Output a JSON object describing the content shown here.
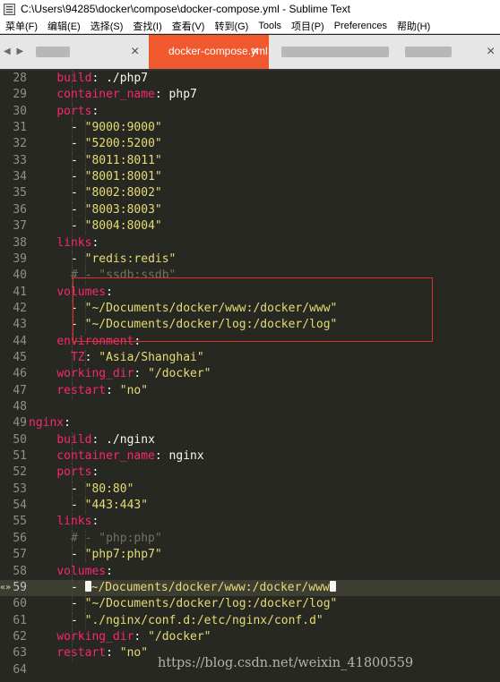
{
  "window": {
    "title": "C:\\Users\\94285\\docker\\compose\\docker-compose.yml - Sublime Text"
  },
  "menu": [
    "菜单(F)",
    "编辑(E)",
    "选择(S)",
    "查找(I)",
    "查看(V)",
    "转到(G)",
    "Tools",
    "项目(P)",
    "Preferences",
    "帮助(H)"
  ],
  "tabs": {
    "nav_arrows": "◀ ▶",
    "active_label": "docker-compose.yml",
    "close_glyph": "×"
  },
  "editor": {
    "lines": [
      {
        "n": "28",
        "indent": 4,
        "tokens": [
          {
            "t": "build",
            "c": "k"
          },
          {
            "t": ": ./php7",
            "c": "p"
          }
        ]
      },
      {
        "n": "29",
        "indent": 4,
        "tokens": [
          {
            "t": "container_name",
            "c": "k"
          },
          {
            "t": ": php7",
            "c": "p"
          }
        ]
      },
      {
        "n": "30",
        "indent": 4,
        "tokens": [
          {
            "t": "ports",
            "c": "k"
          },
          {
            "t": ":",
            "c": "p"
          }
        ]
      },
      {
        "n": "31",
        "indent": 6,
        "tokens": [
          {
            "t": "- ",
            "c": "p"
          },
          {
            "t": "\"9000:9000\"",
            "c": "s"
          }
        ]
      },
      {
        "n": "32",
        "indent": 6,
        "tokens": [
          {
            "t": "- ",
            "c": "p"
          },
          {
            "t": "\"5200:5200\"",
            "c": "s"
          }
        ]
      },
      {
        "n": "33",
        "indent": 6,
        "tokens": [
          {
            "t": "- ",
            "c": "p"
          },
          {
            "t": "\"8011:8011\"",
            "c": "s"
          }
        ]
      },
      {
        "n": "34",
        "indent": 6,
        "tokens": [
          {
            "t": "- ",
            "c": "p"
          },
          {
            "t": "\"8001:8001\"",
            "c": "s"
          }
        ]
      },
      {
        "n": "35",
        "indent": 6,
        "tokens": [
          {
            "t": "- ",
            "c": "p"
          },
          {
            "t": "\"8002:8002\"",
            "c": "s"
          }
        ]
      },
      {
        "n": "36",
        "indent": 6,
        "tokens": [
          {
            "t": "- ",
            "c": "p"
          },
          {
            "t": "\"8003:8003\"",
            "c": "s"
          }
        ]
      },
      {
        "n": "37",
        "indent": 6,
        "tokens": [
          {
            "t": "- ",
            "c": "p"
          },
          {
            "t": "\"8004:8004\"",
            "c": "s"
          }
        ]
      },
      {
        "n": "38",
        "indent": 4,
        "tokens": [
          {
            "t": "links",
            "c": "k"
          },
          {
            "t": ":",
            "c": "p"
          }
        ]
      },
      {
        "n": "39",
        "indent": 6,
        "tokens": [
          {
            "t": "- ",
            "c": "p"
          },
          {
            "t": "\"redis:redis\"",
            "c": "s"
          }
        ]
      },
      {
        "n": "40",
        "indent": 6,
        "tokens": [
          {
            "t": "# - \"ssdb:ssdb\"",
            "c": "c"
          }
        ]
      },
      {
        "n": "41",
        "indent": 4,
        "tokens": [
          {
            "t": "volumes",
            "c": "k"
          },
          {
            "t": ":",
            "c": "p"
          }
        ]
      },
      {
        "n": "42",
        "indent": 6,
        "tokens": [
          {
            "t": "- ",
            "c": "p"
          },
          {
            "t": "\"~/Documents/docker/www:/docker/www\"",
            "c": "s"
          }
        ]
      },
      {
        "n": "43",
        "indent": 6,
        "tokens": [
          {
            "t": "- ",
            "c": "p"
          },
          {
            "t": "\"~/Documents/docker/log:/docker/log\"",
            "c": "s"
          }
        ]
      },
      {
        "n": "44",
        "indent": 4,
        "tokens": [
          {
            "t": "environment",
            "c": "k"
          },
          {
            "t": ":",
            "c": "p"
          }
        ]
      },
      {
        "n": "45",
        "indent": 6,
        "tokens": [
          {
            "t": "TZ",
            "c": "k"
          },
          {
            "t": ": ",
            "c": "p"
          },
          {
            "t": "\"Asia/Shanghai\"",
            "c": "s"
          }
        ]
      },
      {
        "n": "46",
        "indent": 4,
        "tokens": [
          {
            "t": "working_dir",
            "c": "k"
          },
          {
            "t": ": ",
            "c": "p"
          },
          {
            "t": "\"/docker\"",
            "c": "s"
          }
        ]
      },
      {
        "n": "47",
        "indent": 4,
        "tokens": [
          {
            "t": "restart",
            "c": "k"
          },
          {
            "t": ": ",
            "c": "p"
          },
          {
            "t": "\"no\"",
            "c": "s"
          }
        ]
      },
      {
        "n": "48",
        "indent": 0,
        "tokens": []
      },
      {
        "n": "49",
        "indent": 0,
        "tokens": [
          {
            "t": "nginx",
            "c": "k"
          },
          {
            "t": ":",
            "c": "p"
          }
        ]
      },
      {
        "n": "50",
        "indent": 4,
        "tokens": [
          {
            "t": "build",
            "c": "k"
          },
          {
            "t": ": ./nginx",
            "c": "p"
          }
        ]
      },
      {
        "n": "51",
        "indent": 4,
        "tokens": [
          {
            "t": "container_name",
            "c": "k"
          },
          {
            "t": ": nginx",
            "c": "p"
          }
        ]
      },
      {
        "n": "52",
        "indent": 4,
        "tokens": [
          {
            "t": "ports",
            "c": "k"
          },
          {
            "t": ":",
            "c": "p"
          }
        ]
      },
      {
        "n": "53",
        "indent": 6,
        "tokens": [
          {
            "t": "- ",
            "c": "p"
          },
          {
            "t": "\"80:80\"",
            "c": "s"
          }
        ]
      },
      {
        "n": "54",
        "indent": 6,
        "tokens": [
          {
            "t": "- ",
            "c": "p"
          },
          {
            "t": "\"443:443\"",
            "c": "s"
          }
        ]
      },
      {
        "n": "55",
        "indent": 4,
        "tokens": [
          {
            "t": "links",
            "c": "k"
          },
          {
            "t": ":",
            "c": "p"
          }
        ]
      },
      {
        "n": "56",
        "indent": 6,
        "tokens": [
          {
            "t": "# - \"php:php\"",
            "c": "c"
          }
        ]
      },
      {
        "n": "57",
        "indent": 6,
        "tokens": [
          {
            "t": "- ",
            "c": "p"
          },
          {
            "t": "\"php7:php7\"",
            "c": "s"
          }
        ]
      },
      {
        "n": "58",
        "indent": 4,
        "tokens": [
          {
            "t": "volumes",
            "c": "k"
          },
          {
            "t": ":",
            "c": "p"
          }
        ]
      },
      {
        "n": "59",
        "indent": 6,
        "current": true,
        "tokens": [
          {
            "t": "- ",
            "c": "p"
          },
          {
            "t": "\"",
            "c": "s",
            "sel": true
          },
          {
            "t": "~/Documents/docker/www:/docker/www",
            "c": "s"
          },
          {
            "t": "\"",
            "c": "s",
            "sel": true
          }
        ]
      },
      {
        "n": "60",
        "indent": 6,
        "tokens": [
          {
            "t": "- ",
            "c": "p"
          },
          {
            "t": "\"~/Documents/docker/log:/docker/log\"",
            "c": "s"
          }
        ]
      },
      {
        "n": "61",
        "indent": 6,
        "tokens": [
          {
            "t": "- ",
            "c": "p"
          },
          {
            "t": "\"./nginx/conf.d:/etc/nginx/conf.d\"",
            "c": "s"
          }
        ]
      },
      {
        "n": "62",
        "indent": 4,
        "tokens": [
          {
            "t": "working_dir",
            "c": "k"
          },
          {
            "t": ": ",
            "c": "p"
          },
          {
            "t": "\"/docker\"",
            "c": "s"
          }
        ]
      },
      {
        "n": "63",
        "indent": 4,
        "tokens": [
          {
            "t": "restart",
            "c": "k"
          },
          {
            "t": ": ",
            "c": "p"
          },
          {
            "t": "\"no\"",
            "c": "s"
          }
        ]
      },
      {
        "n": "64",
        "indent": 0,
        "tokens": []
      }
    ]
  },
  "fold_marker": "«»",
  "watermark": "https://blog.csdn.net/weixin_41800559",
  "colors": {
    "background": "#272822",
    "key": "#f92672",
    "string": "#e6db74",
    "plain": "#f8f8f2",
    "comment": "#75715e",
    "active_tab": "#f0582d",
    "highlight_box": "#d9322a"
  }
}
